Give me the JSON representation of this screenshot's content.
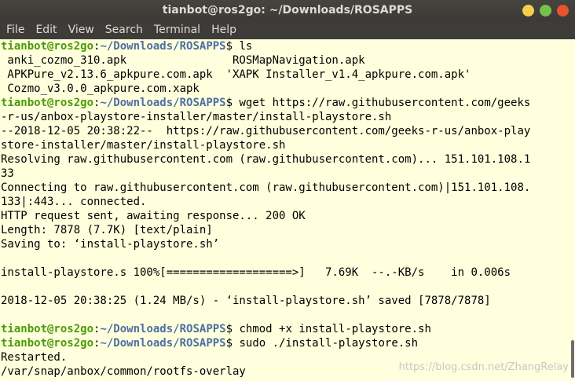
{
  "window": {
    "title": "tianbot@ros2go: ~/Downloads/ROSAPPS"
  },
  "menu": {
    "items": [
      "File",
      "Edit",
      "View",
      "Search",
      "Terminal",
      "Help"
    ]
  },
  "colors": {
    "background": "#ffffdd",
    "prompt_user": "#4a9a06",
    "prompt_path": "#4d6fa3",
    "titlebar": "#3d3c38"
  },
  "terminal": {
    "lines": [
      {
        "user": "tianbot@ros2go",
        "sep": ":",
        "path": "~/Downloads/ROSAPPS",
        "cmd": "$ ls"
      },
      {
        "text": " anki_cozmo_310.apk                ROSMapNavigation.apk"
      },
      {
        "text": " APKPure_v2.13.6_apkpure.com.apk  'XAPK Installer_v1.4_apkpure.com.apk'"
      },
      {
        "text": " Cozmo_v3.0.0_apkpure.com.xapk"
      },
      {
        "user": "tianbot@ros2go",
        "sep": ":",
        "path": "~/Downloads/ROSAPPS",
        "cmd": "$ wget https://raw.githubusercontent.com/geeks"
      },
      {
        "text": "-r-us/anbox-playstore-installer/master/install-playstore.sh"
      },
      {
        "text": "--2018-12-05 20:38:22--  https://raw.githubusercontent.com/geeks-r-us/anbox-play"
      },
      {
        "text": "store-installer/master/install-playstore.sh"
      },
      {
        "text": "Resolving raw.githubusercontent.com (raw.githubusercontent.com)... 151.101.108.1"
      },
      {
        "text": "33"
      },
      {
        "text": "Connecting to raw.githubusercontent.com (raw.githubusercontent.com)|151.101.108."
      },
      {
        "text": "133|:443... connected."
      },
      {
        "text": "HTTP request sent, awaiting response... 200 OK"
      },
      {
        "text": "Length: 7878 (7.7K) [text/plain]"
      },
      {
        "text": "Saving to: ‘install-playstore.sh’"
      },
      {
        "text": ""
      },
      {
        "text": "install-playstore.s 100%[===================>]   7.69K  --.-KB/s    in 0.006s"
      },
      {
        "text": ""
      },
      {
        "text": "2018-12-05 20:38:25 (1.24 MB/s) - ‘install-playstore.sh’ saved [7878/7878]"
      },
      {
        "text": ""
      },
      {
        "user": "tianbot@ros2go",
        "sep": ":",
        "path": "~/Downloads/ROSAPPS",
        "cmd": "$ chmod +x install-playstore.sh"
      },
      {
        "user": "tianbot@ros2go",
        "sep": ":",
        "path": "~/Downloads/ROSAPPS",
        "cmd": "$ sudo ./install-playstore.sh"
      },
      {
        "text": "Restarted."
      },
      {
        "text": "/var/snap/anbox/common/rootfs-overlay"
      }
    ]
  },
  "watermark": "https://blog.csdn.net/ZhangRelay"
}
